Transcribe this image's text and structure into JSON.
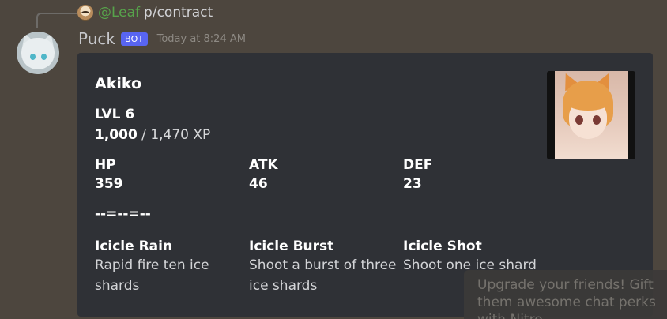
{
  "reply": {
    "mention": "@Leaf",
    "text": "p/contract"
  },
  "author": {
    "name": "Puck",
    "tag": "BOT",
    "timestamp": "Today at 8:24 AM"
  },
  "embed": {
    "title": "Akiko",
    "level": "LVL 6",
    "xp_current": "1,000",
    "xp_rest": " / 1,470 XP",
    "stats": [
      {
        "name": "HP",
        "value": "359"
      },
      {
        "name": "ATK",
        "value": "46"
      },
      {
        "name": "DEF",
        "value": "23"
      }
    ],
    "separator": "--=--=--",
    "skills": [
      {
        "name": "Icicle Rain",
        "desc_line1": "Rapid fire ten ice",
        "desc_line2": "shards"
      },
      {
        "name": "Icicle Burst",
        "desc_line1": "Shoot a burst of three",
        "desc_line2": "ice shards"
      },
      {
        "name": "Icicle Shot",
        "desc_line1": "Shoot one ice shard",
        "desc_line2": ""
      }
    ]
  },
  "toast": {
    "text": "Upgrade your friends! Gift them awesome chat perks with Nitro"
  },
  "colors": {
    "background": "#4d463e",
    "embed_bg": "#2f3136",
    "bot_tag": "#5865f2",
    "mention": "#57a34b"
  }
}
